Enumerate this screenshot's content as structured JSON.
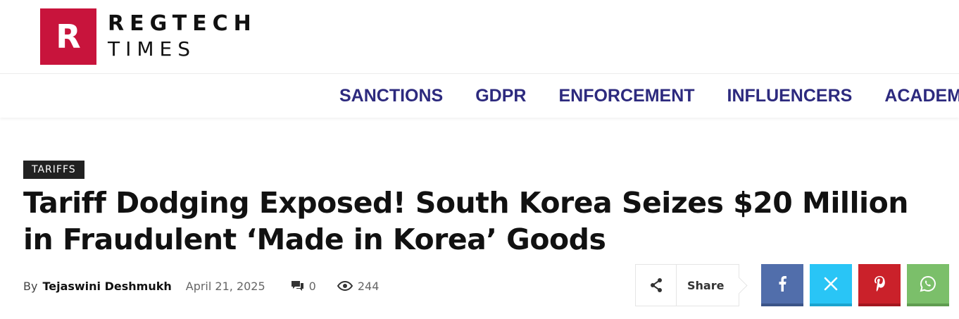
{
  "logo": {
    "letter": "R",
    "line1": "REGTECH",
    "line2": "TIMES",
    "brand_color": "#c8143c"
  },
  "nav": {
    "items": [
      {
        "label": "SANCTIONS"
      },
      {
        "label": "GDPR"
      },
      {
        "label": "ENFORCEMENT"
      },
      {
        "label": "INFLUENCERS"
      },
      {
        "label": "ACADEMY"
      }
    ],
    "color": "#2d2a7e"
  },
  "article": {
    "category": "TARIFFS",
    "title": "Tariff Dodging Exposed! South Korea Seizes $20 Million in Fraudulent ‘Made in Korea’ Goods",
    "by": "By",
    "author": "Tejaswini Deshmukh",
    "date": "April 21, 2025",
    "comments": "0",
    "views": "244"
  },
  "share": {
    "label": "Share",
    "buttons": [
      {
        "name": "facebook",
        "icon": "facebook-icon",
        "color": "#516eab"
      },
      {
        "name": "x",
        "icon": "x-icon",
        "color": "#29c5f6"
      },
      {
        "name": "pinterest",
        "icon": "pinterest-icon",
        "color": "#ca212a"
      },
      {
        "name": "whatsapp",
        "icon": "whatsapp-icon",
        "color": "#7bbf6a"
      }
    ]
  }
}
